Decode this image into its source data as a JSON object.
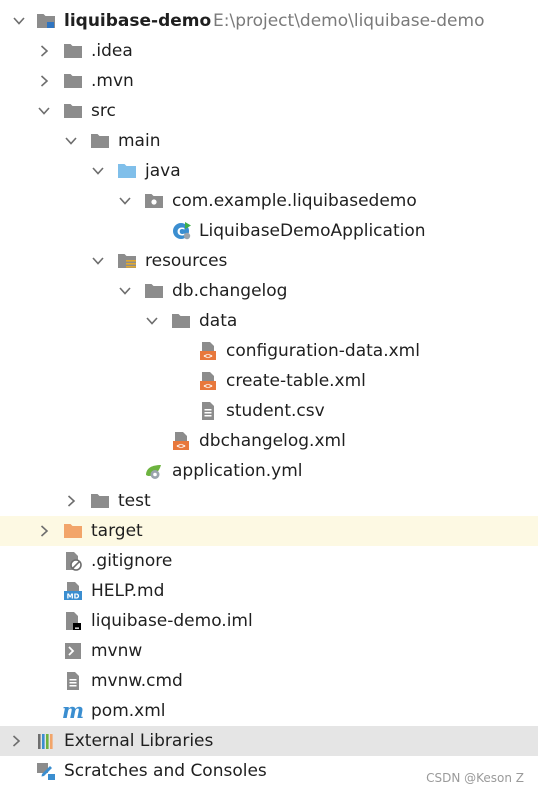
{
  "project": {
    "name": "liquibase-demo",
    "path": "E:\\project\\demo\\liquibase-demo"
  },
  "tree": {
    "idea": ".idea",
    "mvn": ".mvn",
    "src": "src",
    "main": "main",
    "java": "java",
    "package": "com.example.liquibasedemo",
    "app_class": "LiquibaseDemoApplication",
    "resources": "resources",
    "db_changelog": "db.changelog",
    "data": "data",
    "configuration_data": "configuration-data.xml",
    "create_table": "create-table.xml",
    "student_csv": "student.csv",
    "dbchangelog": "dbchangelog.xml",
    "application_yml": "application.yml",
    "test": "test",
    "target": "target",
    "gitignore": ".gitignore",
    "help_md": "HELP.md",
    "iml": "liquibase-demo.iml",
    "mvnw": "mvnw",
    "mvnw_cmd": "mvnw.cmd",
    "pom": "pom.xml"
  },
  "external_libraries": "External Libraries",
  "scratches": "Scratches and Consoles",
  "watermark": "CSDN @Keson Z"
}
